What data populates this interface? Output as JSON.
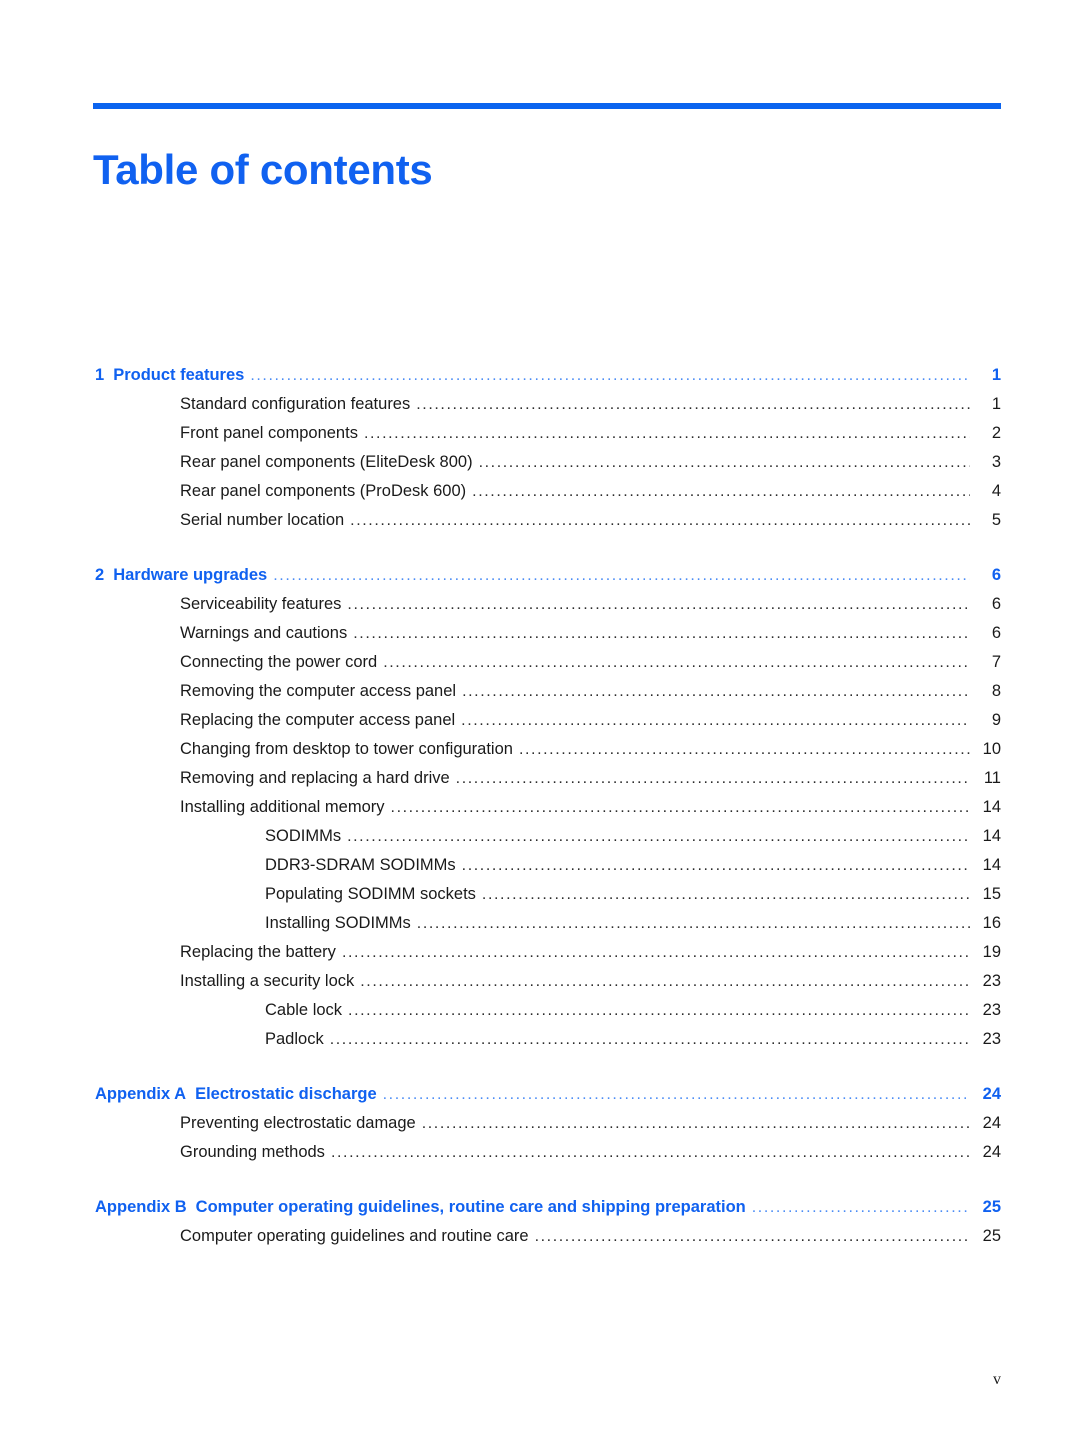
{
  "document": {
    "title": "Table of contents",
    "accent_color": "#1061f0",
    "rule_color": "#0b64ef",
    "body_text_color": "#1a1a1a",
    "footer_page_number": "v"
  },
  "toc": {
    "groups": [
      {
        "heading": {
          "number": "1",
          "label": "Product features",
          "page": "1",
          "level": 0
        },
        "entries": [
          {
            "label": "Standard configuration features",
            "page": "1",
            "level": 1
          },
          {
            "label": "Front panel components",
            "page": "2",
            "level": 1
          },
          {
            "label": "Rear panel components (EliteDesk 800)",
            "page": "3",
            "level": 1
          },
          {
            "label": "Rear panel components (ProDesk 600)",
            "page": "4",
            "level": 1
          },
          {
            "label": "Serial number location",
            "page": "5",
            "level": 1
          }
        ]
      },
      {
        "heading": {
          "number": "2",
          "label": "Hardware upgrades",
          "page": "6",
          "level": 0
        },
        "entries": [
          {
            "label": "Serviceability features",
            "page": "6",
            "level": 1
          },
          {
            "label": "Warnings and cautions",
            "page": "6",
            "level": 1
          },
          {
            "label": "Connecting the power cord",
            "page": "7",
            "level": 1
          },
          {
            "label": "Removing the computer access panel",
            "page": "8",
            "level": 1
          },
          {
            "label": "Replacing the computer access panel",
            "page": "9",
            "level": 1
          },
          {
            "label": "Changing from desktop to tower configuration",
            "page": "10",
            "level": 1
          },
          {
            "label": "Removing and replacing a hard drive",
            "page": "11",
            "level": 1
          },
          {
            "label": "Installing additional memory",
            "page": "14",
            "level": 1
          },
          {
            "label": "SODIMMs",
            "page": "14",
            "level": 2
          },
          {
            "label": "DDR3-SDRAM SODIMMs",
            "page": "14",
            "level": 2
          },
          {
            "label": "Populating SODIMM sockets",
            "page": "15",
            "level": 2
          },
          {
            "label": "Installing SODIMMs",
            "page": "16",
            "level": 2
          },
          {
            "label": "Replacing the battery",
            "page": "19",
            "level": 1
          },
          {
            "label": "Installing a security lock",
            "page": "23",
            "level": 1
          },
          {
            "label": "Cable lock",
            "page": "23",
            "level": 2
          },
          {
            "label": "Padlock",
            "page": "23",
            "level": 2
          }
        ]
      },
      {
        "heading": {
          "number": "Appendix A",
          "label": "Electrostatic discharge",
          "page": "24",
          "level": 0
        },
        "entries": [
          {
            "label": "Preventing electrostatic damage",
            "page": "24",
            "level": 1
          },
          {
            "label": "Grounding methods",
            "page": "24",
            "level": 1
          }
        ]
      },
      {
        "heading": {
          "number": "Appendix B",
          "label": "Computer operating guidelines, routine care and shipping preparation",
          "page": "25",
          "level": 0
        },
        "entries": [
          {
            "label": "Computer operating guidelines and routine care",
            "page": "25",
            "level": 1
          }
        ]
      }
    ]
  }
}
